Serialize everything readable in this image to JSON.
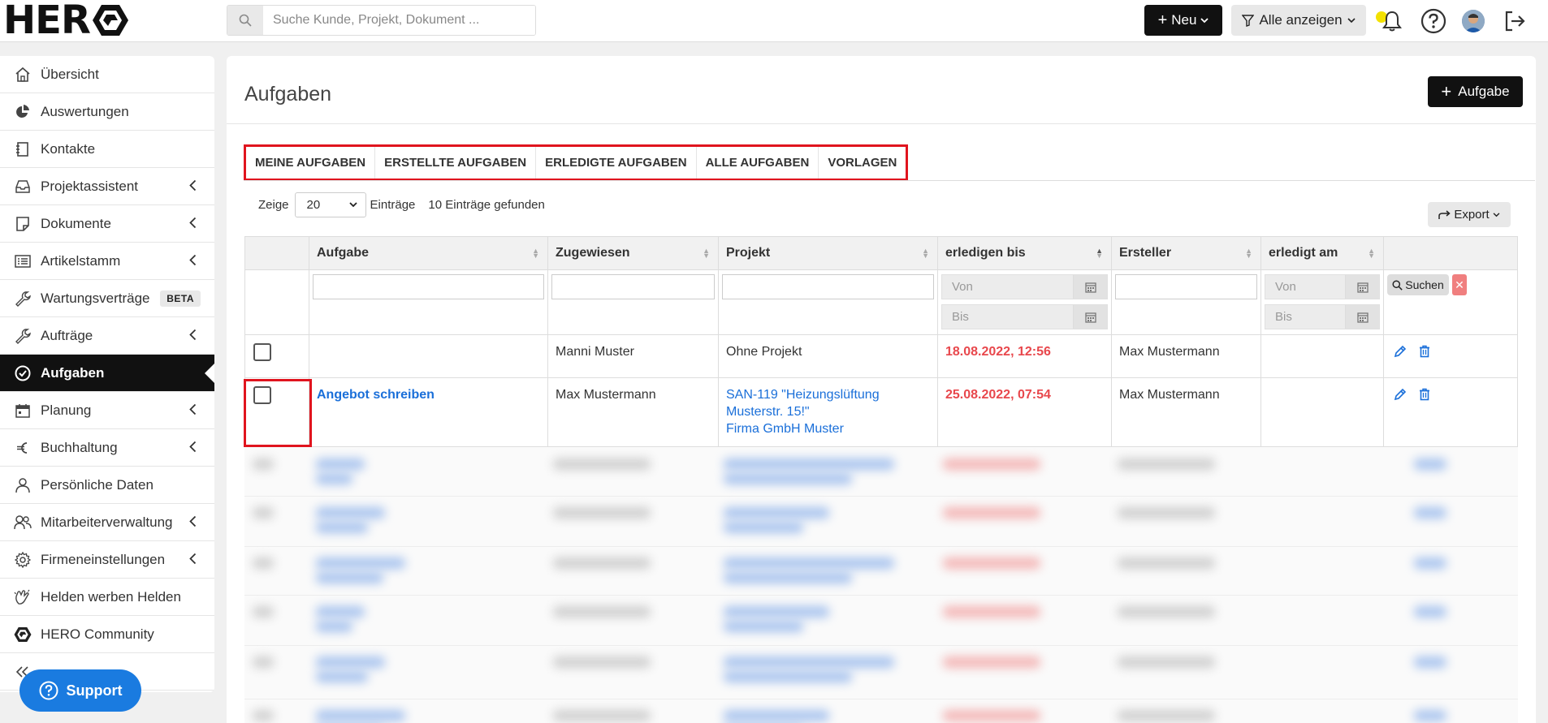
{
  "topbar": {
    "logo_text": "HER",
    "search_placeholder": "Suche Kunde, Projekt, Dokument ...",
    "new_label": "Neu",
    "filter_label": "Alle anzeigen"
  },
  "sidebar": {
    "items": [
      {
        "label": "Übersicht",
        "icon": "home-icon"
      },
      {
        "label": "Auswertungen",
        "icon": "pie-chart-icon"
      },
      {
        "label": "Kontakte",
        "icon": "address-book-icon"
      },
      {
        "label": "Projektassistent",
        "icon": "inbox-icon",
        "expandable": true
      },
      {
        "label": "Dokumente",
        "icon": "document-icon",
        "expandable": true
      },
      {
        "label": "Artikelstamm",
        "icon": "list-icon",
        "expandable": true
      },
      {
        "label": "Wartungsverträge",
        "icon": "wrench-icon",
        "badge": "BETA"
      },
      {
        "label": "Aufträge",
        "icon": "tools-icon",
        "expandable": true
      },
      {
        "label": "Aufgaben",
        "icon": "check-circle-icon",
        "active": true
      },
      {
        "label": "Planung",
        "icon": "calendar-icon",
        "expandable": true
      },
      {
        "label": "Buchhaltung",
        "icon": "euro-icon",
        "expandable": true
      },
      {
        "label": "Persönliche Daten",
        "icon": "user-icon"
      },
      {
        "label": "Mitarbeiterverwaltung",
        "icon": "users-icon",
        "expandable": true
      },
      {
        "label": "Firmeneinstellungen",
        "icon": "gear-icon",
        "expandable": true
      },
      {
        "label": "Helden werben Helden",
        "icon": "clap-icon"
      },
      {
        "label": "HERO Community",
        "icon": "hero-logo-icon"
      }
    ],
    "support_label": "Support"
  },
  "main": {
    "title": "Aufgaben",
    "add_label": "Aufgabe",
    "tabs": [
      "MEINE AUFGABEN",
      "ERSTELLTE AUFGABEN",
      "ERLEDIGTE AUFGABEN",
      "ALLE AUFGABEN",
      "VORLAGEN"
    ],
    "show_label": "Zeige",
    "page_size": "20",
    "entries_label": "Einträge",
    "found_label": "10 Einträge gefunden",
    "export_label": "Export",
    "columns": [
      "Aufgabe",
      "Zugewiesen",
      "Projekt",
      "erledigen bis",
      "Ersteller",
      "erledigt am"
    ],
    "filter": {
      "von": "Von",
      "bis": "Bis",
      "search_label": "Suchen",
      "clear_label": "✕"
    },
    "rows": [
      {
        "task": "",
        "assigned": "Manni Muster",
        "project_lines": [
          "Ohne Projekt"
        ],
        "project_link": false,
        "due": "18.08.2022, 12:56",
        "creator": "Max Mustermann",
        "done": ""
      },
      {
        "task": "Angebot schreiben",
        "assigned": "Max Mustermann",
        "project_lines": [
          "SAN-119 \"Heizungslüftung",
          "Musterstr. 15!\"",
          "Firma GmbH Muster"
        ],
        "project_link": true,
        "due": "25.08.2022, 07:54",
        "creator": "Max Mustermann",
        "done": ""
      }
    ]
  },
  "colors": {
    "accent": "#1a6fd9",
    "due_red": "#e8474c",
    "highlight_red": "#e0141e",
    "dark": "#111111"
  }
}
